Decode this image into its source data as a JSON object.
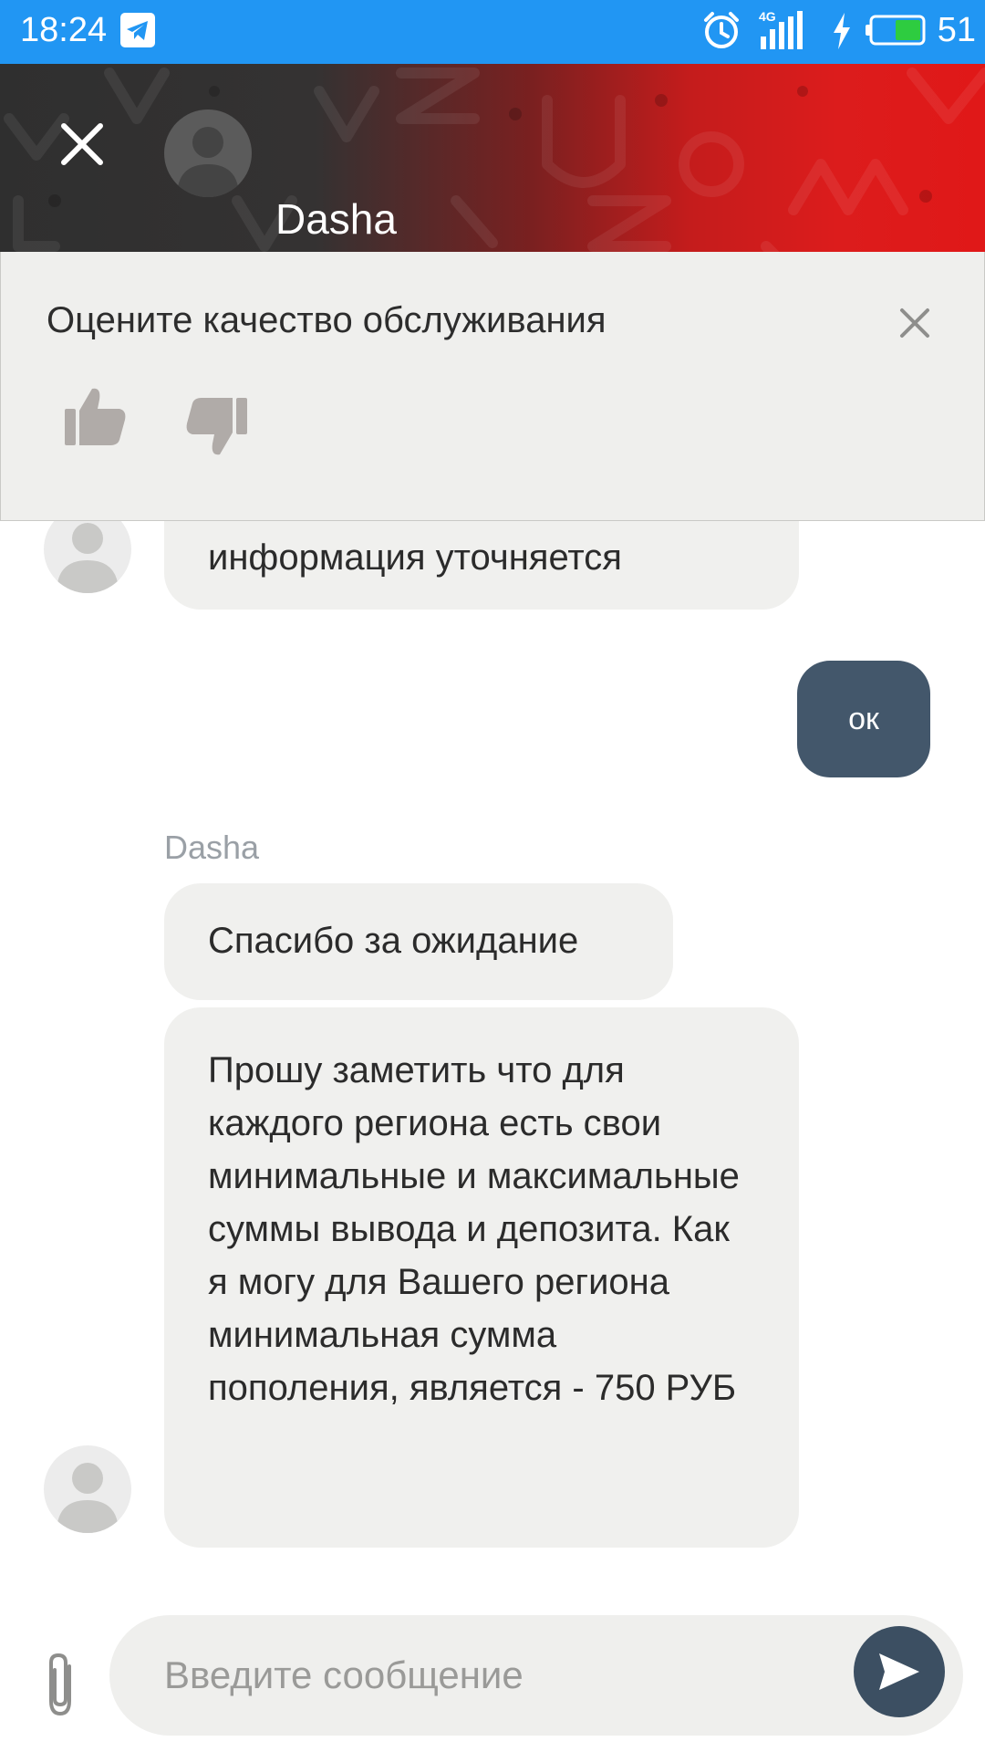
{
  "status_bar": {
    "time": "18:24",
    "network": "4G",
    "battery_level": "51",
    "icons": [
      "telegram-icon",
      "alarm-icon",
      "signal-icon",
      "charging-icon",
      "battery-icon"
    ]
  },
  "header": {
    "contact_name": "Dasha",
    "icons": [
      "close-icon",
      "avatar-icon"
    ]
  },
  "rating_panel": {
    "title": "Оцените качество обслуживания",
    "icons": [
      "close-icon",
      "thumbs-up-icon",
      "thumbs-down-icon"
    ]
  },
  "messages": [
    {
      "from": "agent",
      "text": "информация уточняется"
    },
    {
      "from": "user",
      "text": "ок"
    },
    {
      "from": "agent",
      "sender": "Dasha",
      "text": "Спасибо за ожидание"
    },
    {
      "from": "agent",
      "text": "Прошу заметить что для каждого региона есть свои минимальные и максимальные суммы вывода и депозита. Как я могу для Вашего региона минимальная сумма пополения, является - 750 РУБ"
    }
  ],
  "composer": {
    "placeholder": "Введите сообщение",
    "value": "",
    "icons": [
      "paperclip-icon",
      "send-icon"
    ]
  },
  "colors": {
    "status_bar": "#2196f3",
    "header_dark": "#2f2f2f",
    "header_red": "#e01818",
    "incoming_bubble": "#f0f0ee",
    "outgoing_bubble": "#43576b",
    "send_button": "#3c4f62"
  }
}
